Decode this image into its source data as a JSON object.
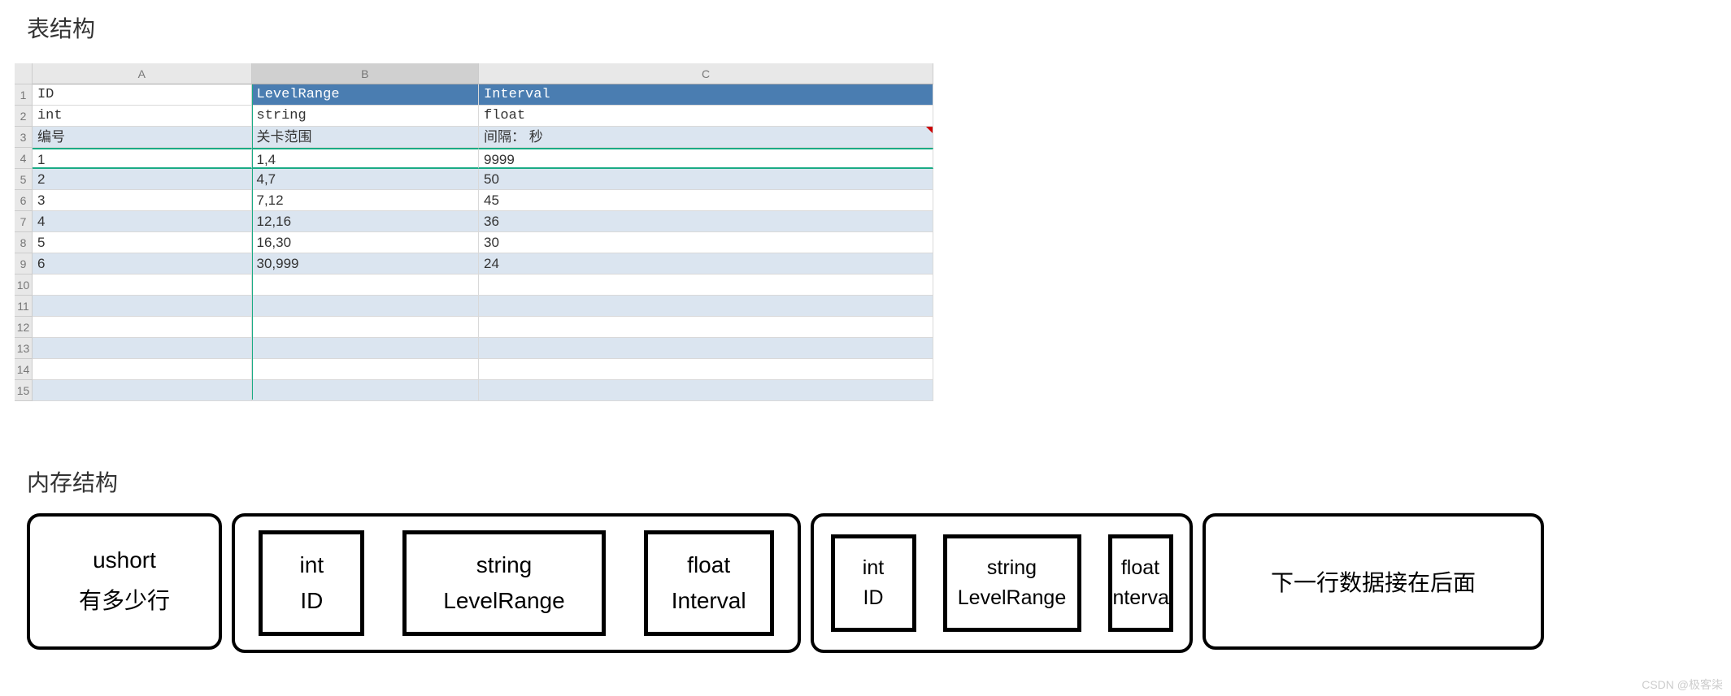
{
  "headings": {
    "h1": "表结构",
    "h2": "内存结构"
  },
  "sheet": {
    "col_headers": {
      "A": "A",
      "B": "B",
      "C": "C"
    },
    "row_labels": [
      "1",
      "2",
      "3",
      "4",
      "5",
      "6",
      "7",
      "8",
      "9",
      "10",
      "11",
      "12",
      "13",
      "14",
      "15"
    ],
    "header_row": {
      "A": "ID",
      "B": "LevelRange",
      "C": "Interval"
    },
    "type_row": {
      "A": "int",
      "B": "string",
      "C": "float"
    },
    "desc_row": {
      "A": "编号",
      "B": "关卡范围",
      "C": "间隔：  秒"
    },
    "data": [
      {
        "A": "1",
        "B": "1,4",
        "C": "9999"
      },
      {
        "A": "2",
        "B": "4,7",
        "C": "50"
      },
      {
        "A": "3",
        "B": "7,12",
        "C": "45"
      },
      {
        "A": "4",
        "B": "12,16",
        "C": "36"
      },
      {
        "A": "5",
        "B": "16,30",
        "C": "30"
      },
      {
        "A": "6",
        "B": "30,999",
        "C": "24"
      }
    ]
  },
  "memory": {
    "block1": {
      "line1": "ushort",
      "line2": "有多少行"
    },
    "row1": {
      "c1": {
        "line1": "int",
        "line2": "ID"
      },
      "c2": {
        "line1": "string",
        "line2": "LevelRange"
      },
      "c3": {
        "line1": "float",
        "line2": "Interval"
      }
    },
    "row2": {
      "c1": {
        "line1": "int",
        "line2": "ID"
      },
      "c2": {
        "line1": "string",
        "line2": "LevelRange"
      },
      "c3": {
        "line1": "float",
        "line2": "Interval"
      }
    },
    "next": "下一行数据接在后面"
  },
  "watermark": "CSDN @极客柒"
}
